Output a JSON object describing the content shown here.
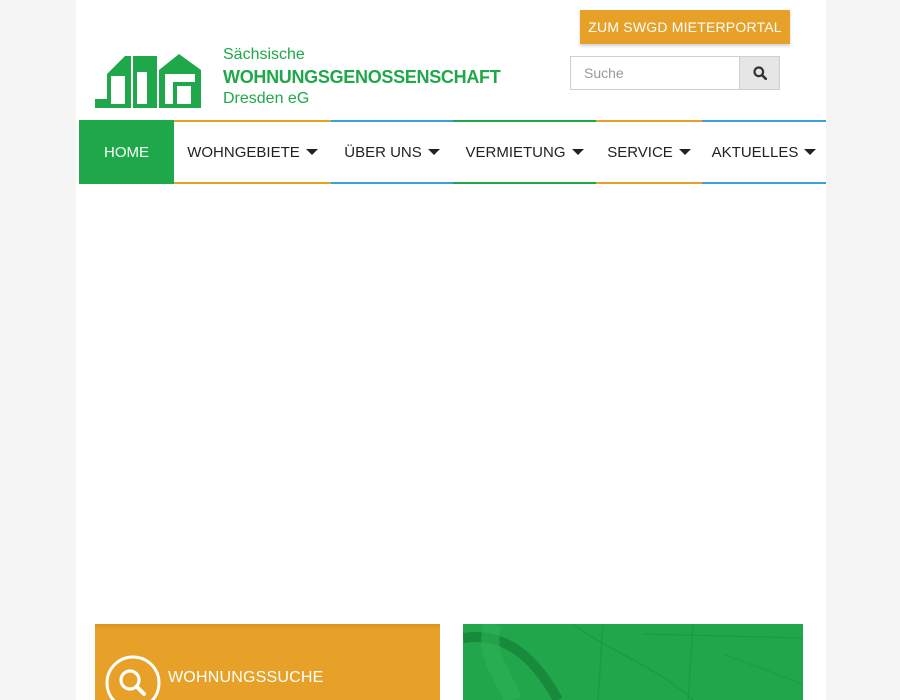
{
  "header": {
    "portal_button": "ZUM SWGD MIETERPORTAL",
    "logo": {
      "line1": "Sächsische",
      "line2": "WOHNUNGSGENOSSENSCHAFT",
      "line3": "Dresden eG"
    },
    "search": {
      "placeholder": "Suche",
      "value": ""
    }
  },
  "nav": {
    "items": [
      {
        "label": "HOME",
        "active": true,
        "has_submenu": false
      },
      {
        "label": "WOHNGEBIETE",
        "active": false,
        "has_submenu": true,
        "accent": "#e8a128"
      },
      {
        "label": "ÜBER UNS",
        "active": false,
        "has_submenu": true,
        "accent": "#3aa0d8"
      },
      {
        "label": "VERMIETUNG",
        "active": false,
        "has_submenu": true,
        "accent": "#1ea84a"
      },
      {
        "label": "SERVICE",
        "active": false,
        "has_submenu": true,
        "accent": "#e8a128"
      },
      {
        "label": "AKTUELLES",
        "active": false,
        "has_submenu": true,
        "accent": "#3aa0d8"
      }
    ]
  },
  "cards": {
    "apartment_search": {
      "label": "WOHNUNGSSUCHE",
      "icon": "search-icon"
    },
    "map": {
      "icon": "map-image"
    }
  },
  "colors": {
    "brand_green": "#1ea84a",
    "accent_orange": "#e8a128",
    "accent_blue": "#3aa0d8",
    "page_background": "#f5f5f5"
  }
}
